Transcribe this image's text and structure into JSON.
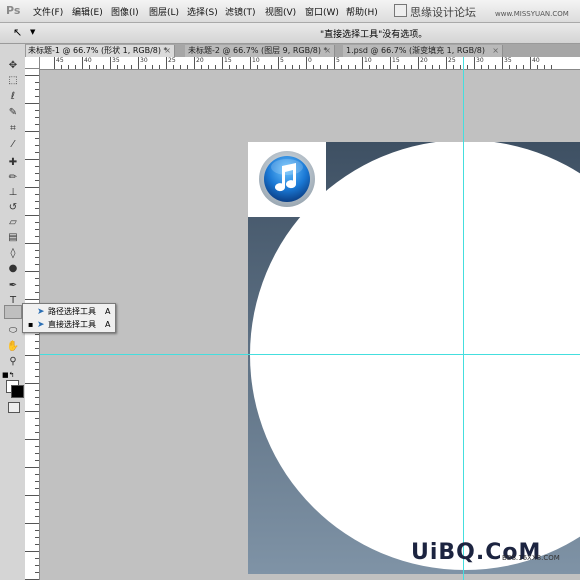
{
  "app": {
    "logo": "Ps"
  },
  "menu": [
    "文件(F)",
    "编辑(E)",
    "图像(I)",
    "图层(L)",
    "选择(S)",
    "滤镜(T)",
    "视图(V)",
    "窗口(W)",
    "帮助(H)"
  ],
  "watermark_top": "思缘设计论坛",
  "watermark_url": "www.MISSYUAN.COM",
  "options_bar": {
    "message": "\"直接选择工具\"没有选项。"
  },
  "tabs": [
    {
      "label": "未标题-1 @ 66.7% (形状 1, RGB/8) *",
      "active": true
    },
    {
      "label": "未标题-2 @ 66.7% (图层 9, RGB/8) *",
      "active": false
    },
    {
      "label": "1.psd @ 66.7% (渐变填充 1, RGB/8)",
      "active": false
    }
  ],
  "tab_close": "×",
  "ruler_top_labels": [
    "45",
    "40",
    "35",
    "30",
    "25",
    "20",
    "15",
    "10",
    "5",
    "0",
    "5",
    "10",
    "15",
    "20",
    "25",
    "30",
    "35",
    "40"
  ],
  "flyout": [
    {
      "label": "路径选择工具",
      "shortcut": "A",
      "selected": false
    },
    {
      "label": "直接选择工具",
      "shortcut": "A",
      "selected": true
    }
  ],
  "bottom_logo": "UiBQ.CoM",
  "bottom_small": "BBS.16XX8.COM",
  "colors": {
    "guide": "#44dede",
    "canvas_top": "#3e5063",
    "canvas_bottom": "#7f93a6",
    "itunes_blue": "#1a78d4"
  },
  "icons": [
    "move-icon",
    "marquee-icon",
    "lasso-icon",
    "quick-select-icon",
    "crop-icon",
    "eyedropper-icon",
    "healing-icon",
    "brush-icon",
    "stamp-icon",
    "history-brush-icon",
    "eraser-icon",
    "gradient-icon",
    "blur-icon",
    "dodge-icon",
    "pen-icon",
    "type-icon",
    "path-select-icon",
    "shape-icon",
    "hand-icon",
    "zoom-icon",
    "itunes-icon"
  ]
}
